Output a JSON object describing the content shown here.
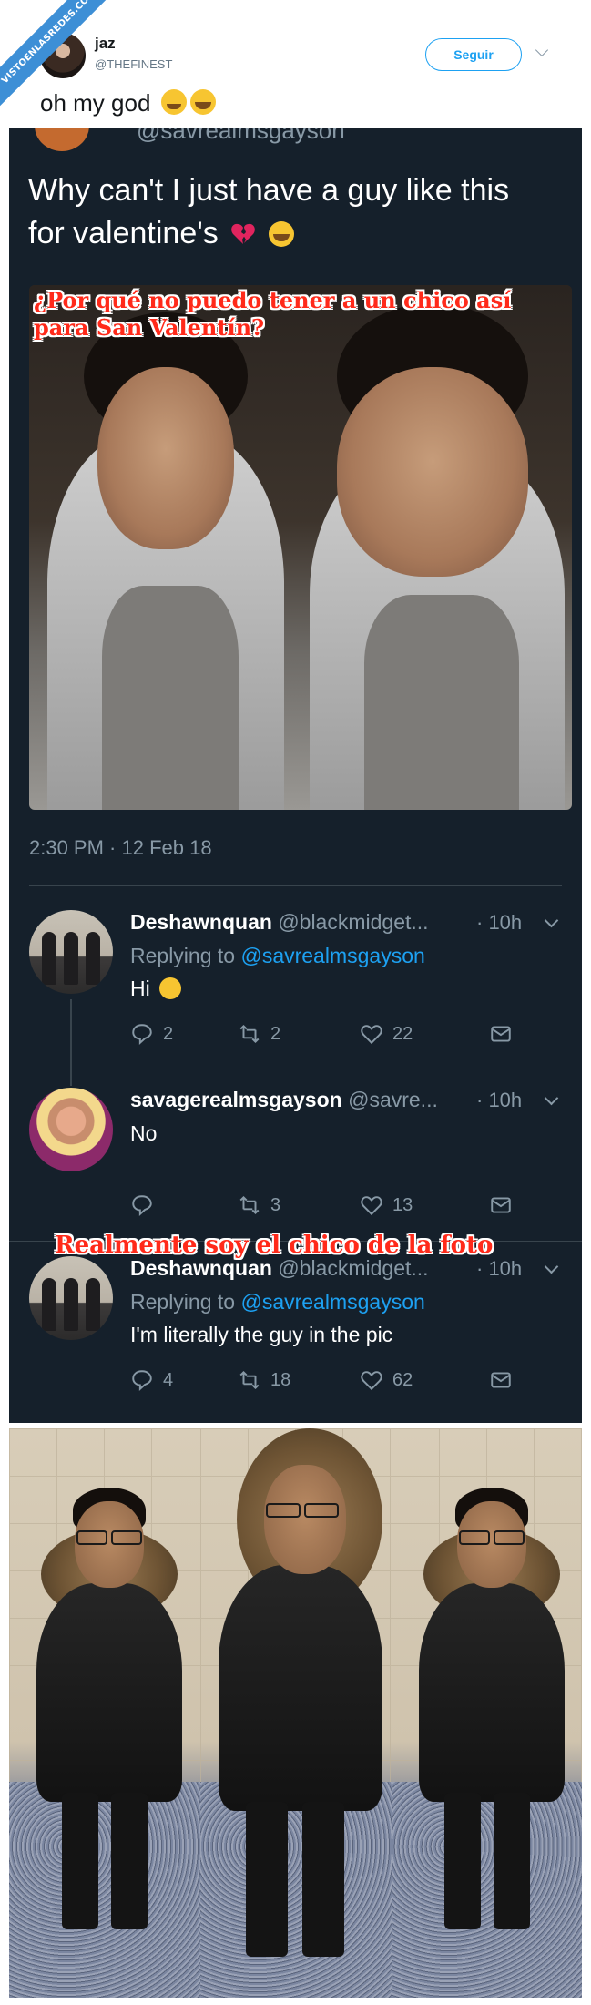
{
  "watermark": "VISTOENLASREDES.COM",
  "outer_tweet": {
    "name": "jaz",
    "handle": "@THEFINEST",
    "follow_label": "Seguir",
    "text": "oh my god"
  },
  "quoted": {
    "partial_handle": "@savrealmsgayson",
    "text": "Why can't I just have a guy like this for valentine's",
    "overlay_caption": "¿Por qué no puedo tener a un chico así para San Valentín?",
    "timestamp": "2:30 PM · 12 Feb 18"
  },
  "replies": [
    {
      "name": "Deshawnquan",
      "handle": "@blackmidget...",
      "time": "· 10h",
      "replying_prefix": "Replying to",
      "replying_to": "@savrealmsgayson",
      "text": "Hi",
      "counts": {
        "reply": "2",
        "retweet": "2",
        "like": "22"
      }
    },
    {
      "name": "savagerealmsgayson",
      "handle": "@savre...",
      "time": "· 10h",
      "text": "No",
      "counts": {
        "reply": "",
        "retweet": "3",
        "like": "13"
      }
    },
    {
      "name": "Deshawnquan",
      "handle": "@blackmidget...",
      "time": "· 10h",
      "replying_prefix": "Replying to",
      "replying_to": "@savrealmsgayson",
      "text": "I'm literally the guy in the pic",
      "counts": {
        "reply": "4",
        "retweet": "18",
        "like": "62"
      }
    }
  ],
  "overlay_caption_2": "Realmente soy el chico de la foto",
  "colors": {
    "dark_bg": "#15202b",
    "accent": "#1da1f2",
    "muted": "#8899a6",
    "caption_red": "#ff2a1a"
  }
}
